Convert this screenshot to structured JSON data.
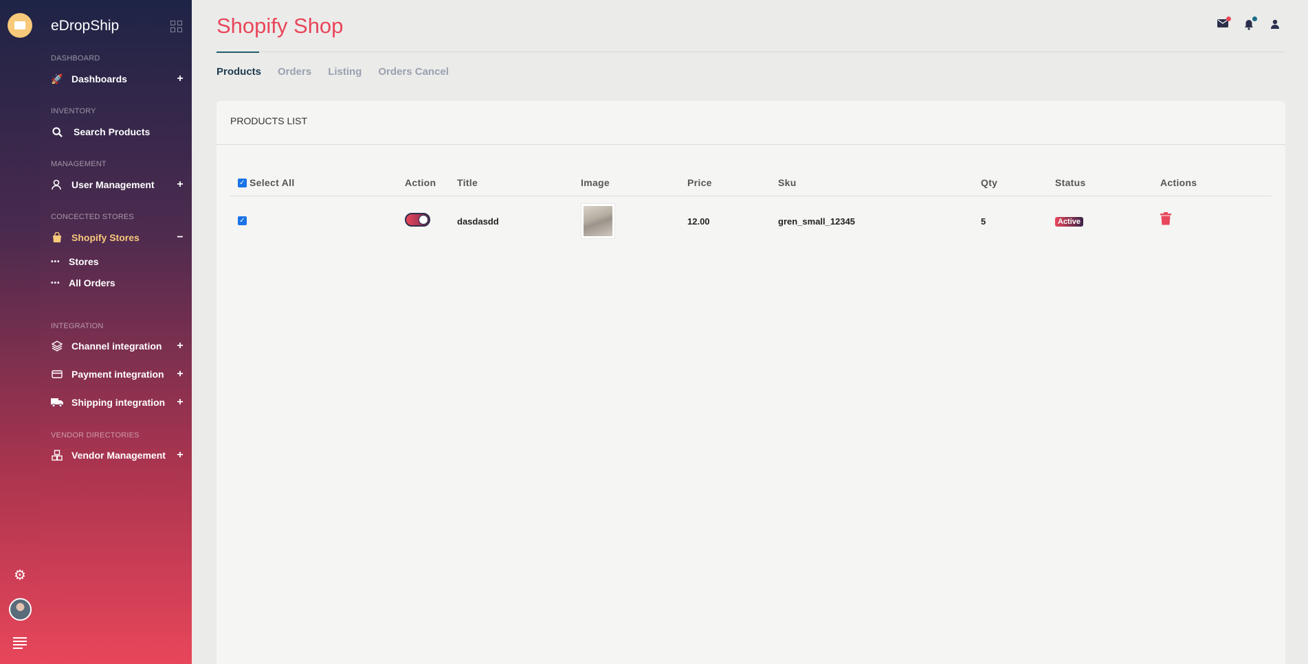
{
  "app": {
    "brand": "eDropShip",
    "page_title": "Shopify Shop"
  },
  "colors": {
    "accent": "#e8465a",
    "brand_gold": "#f7c97a",
    "nav_dark": "#1e2446",
    "tab_active": "#1b3b4f"
  },
  "sidebar": {
    "sections": {
      "dashboard": "DASHBOARD",
      "inventory": "INVENTORY",
      "management": "MANAGEMENT",
      "stores": "CONCECTED STORES",
      "integration": "INTEGRATION",
      "vendor": "VENDOR DIRECTORIES"
    },
    "items": {
      "dashboards": {
        "label": "Dashboards",
        "toggle": "+"
      },
      "search_products": {
        "label": "Search Products"
      },
      "user_management": {
        "label": "User Management",
        "toggle": "+"
      },
      "shopify_stores": {
        "label": "Shopify Stores",
        "toggle": "−"
      },
      "stores": {
        "label": "Stores"
      },
      "all_orders": {
        "label": "All Orders"
      },
      "channel": {
        "label": "Channel integration",
        "toggle": "+"
      },
      "payment": {
        "label": "Payment integration",
        "toggle": "+"
      },
      "shipping": {
        "label": "Shipping integration",
        "toggle": "+"
      },
      "vendor_mgmt": {
        "label": "Vendor Management",
        "toggle": "+"
      }
    }
  },
  "tabs": [
    "Products",
    "Orders",
    "Listing",
    "Orders Cancel"
  ],
  "products": {
    "title": "PRODUCTS LIST",
    "headers": {
      "select_all": "Select All",
      "action": "Action",
      "title": "Title",
      "image": "Image",
      "price": "Price",
      "sku": "Sku",
      "qty": "Qty",
      "status": "Status",
      "actions": "Actions"
    },
    "rows": [
      {
        "checked": true,
        "enabled": true,
        "title": "dasdasdd",
        "price": "12.00",
        "sku": "gren_small_12345",
        "qty": "5",
        "status": "Active"
      }
    ]
  }
}
